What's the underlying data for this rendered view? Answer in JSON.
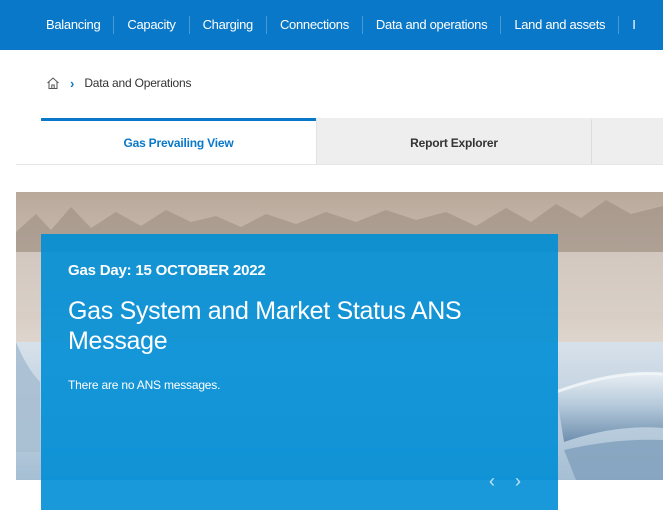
{
  "nav": {
    "items": [
      {
        "label": "Balancing"
      },
      {
        "label": "Capacity"
      },
      {
        "label": "Charging"
      },
      {
        "label": "Connections"
      },
      {
        "label": "Data and operations"
      },
      {
        "label": "Land and assets"
      },
      {
        "label": "I"
      }
    ]
  },
  "breadcrumb": {
    "home_icon": "home-icon",
    "separator_icon": "chevron-right-icon",
    "current": "Data and Operations"
  },
  "tabs": [
    {
      "label": "Gas Prevailing View",
      "active": true
    },
    {
      "label": "Report Explorer",
      "active": false
    },
    {
      "label": "",
      "active": false
    }
  ],
  "panel": {
    "gas_day": "Gas Day: 15 OCTOBER 2022",
    "title": "Gas System and Market Status ANS Message",
    "message": "There are no ANS messages.",
    "prev_glyph": "‹",
    "next_glyph": "›"
  },
  "colors": {
    "brand_blue": "#0a78c8",
    "panel_blue": "#008ed6",
    "tab_inactive": "#eeeeee"
  }
}
